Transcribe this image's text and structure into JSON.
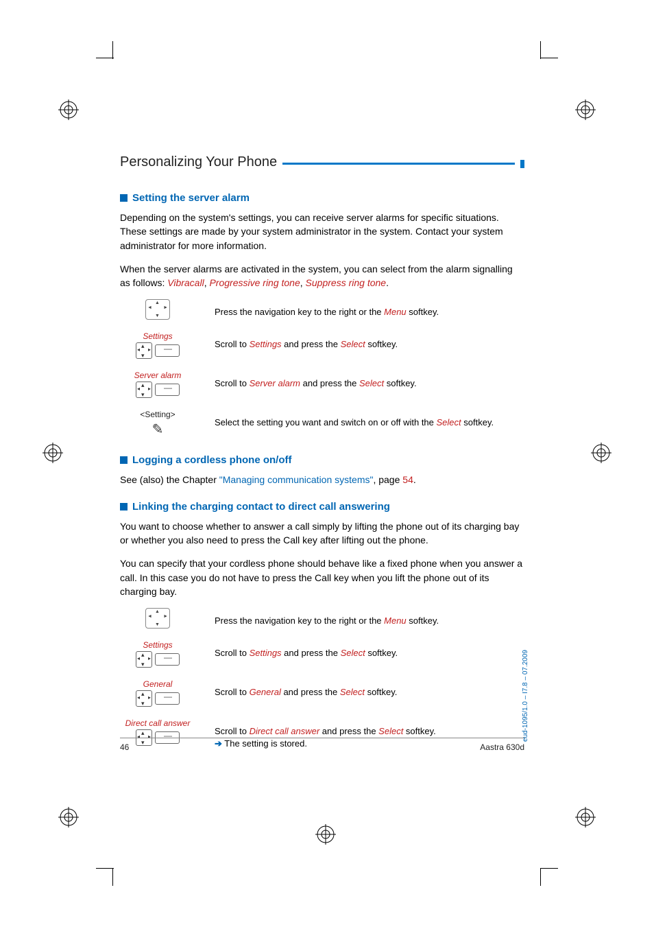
{
  "header": {
    "title": "Personalizing Your Phone"
  },
  "sections": {
    "server_alarm": {
      "heading": "Setting the server alarm",
      "p1_a": "Depending on the system's settings, you can receive server alarms for specific situations. These settings are made by your system administrator in the system. Contact your system administrator for more information.",
      "p2_a": "When the server alarms are activated in the system, you can select from the alarm signalling as follows: ",
      "terms": {
        "t1": "Vibracall",
        "t2": "Progressive ring tone",
        "t3": "Suppress ring tone"
      },
      "steps": {
        "s1": {
          "desc_a": "Press the navigation key to the right or the ",
          "menu": "Menu",
          "desc_b": " softkey."
        },
        "s2": {
          "caption": "Settings",
          "desc_a": "Scroll to ",
          "t": "Settings",
          "desc_b": " and press the ",
          "sel": "Select ",
          "desc_c": "softkey."
        },
        "s3": {
          "caption": "Server alarm",
          "desc_a": "Scroll to ",
          "t": "Server alarm",
          "desc_b": " and press the ",
          "sel": "Select",
          "desc_c": " softkey."
        },
        "s4": {
          "caption": "<Setting>",
          "desc_a": "Select the setting you want and switch on or off with the ",
          "sel": "Select",
          "desc_b": " softkey."
        }
      }
    },
    "logging": {
      "heading": "Logging a cordless phone on/off",
      "p_a": "See (also) the Chapter ",
      "link": "\"Managing communication systems\"",
      "p_b": ", page ",
      "page": "54",
      "p_c": "."
    },
    "charging": {
      "heading": "Linking the charging contact to direct call answering",
      "p1": "You want to choose whether to answer a call simply by lifting the phone out of its charging bay or whether you also need to press the Call key after lifting out the phone.",
      "p2": "You can specify that your cordless phone should behave like a fixed phone when you answer a call. In this case you do not have to press the Call key when you lift the phone out of its charging bay.",
      "steps": {
        "s1": {
          "desc_a": "Press the navigation key to the right or the ",
          "menu": "Menu",
          "desc_b": " softkey."
        },
        "s2": {
          "caption": "Settings",
          "desc_a": "Scroll to ",
          "t": "Settings",
          "desc_b": " and press the ",
          "sel": "Select ",
          "desc_c": "softkey."
        },
        "s3": {
          "caption": "General",
          "desc_a": "Scroll to ",
          "t": "General",
          "desc_b": " and press the ",
          "sel": "Select",
          "desc_c": " softkey."
        },
        "s4": {
          "caption": "Direct call answer",
          "desc_a": "Scroll to ",
          "t": "Direct call answer",
          "desc_b": " and press the ",
          "sel": "Select",
          "desc_c": " softkey.",
          "result": " The setting is stored."
        }
      }
    }
  },
  "footer": {
    "page": "46",
    "model": "Aastra 630d"
  },
  "side": "eud-1095/1.0 – I7.8 – 07.2009"
}
